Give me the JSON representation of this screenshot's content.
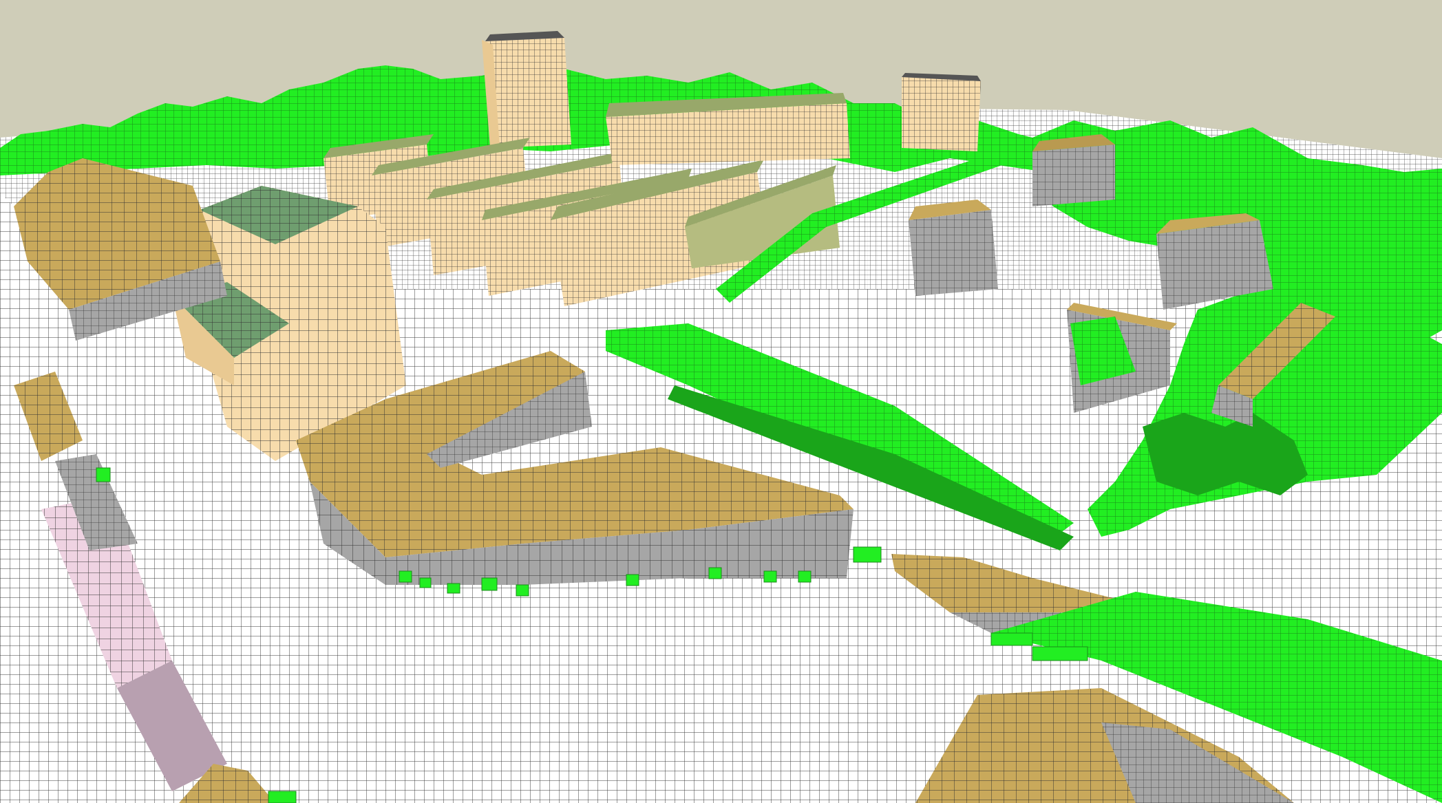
{
  "scene": {
    "kind": "voxelized-3d-city-model",
    "view": "perspective-aerial",
    "colors": {
      "sky": "#cfcdb8",
      "ground": "#ffffff",
      "grid_line": "#222222",
      "vegetation": "#22ee22",
      "vegetation_dark": "#1aa51a",
      "roof_ochre": "#c9a95b",
      "roof_green": "#6f9e6f",
      "facade_cream": "#f7dcac",
      "facade_gray": "#a6a6a6",
      "facade_pink": "#efd3e2",
      "edge": "#333333"
    },
    "elements": [
      {
        "name": "ground-grid",
        "material": "ground"
      },
      {
        "name": "tower-left-tall",
        "material": "facade_cream"
      },
      {
        "name": "tower-center-distant",
        "material": "facade_cream"
      },
      {
        "name": "slab-block-row-cream",
        "material": "facade_cream"
      },
      {
        "name": "ochre-roof-slab-building",
        "material": "roof_ochre"
      },
      {
        "name": "green-roof-tower",
        "material": "roof_green"
      },
      {
        "name": "gray-cube-building",
        "material": "facade_gray"
      },
      {
        "name": "pink-facade-building",
        "material": "facade_pink"
      },
      {
        "name": "railway-vegetation-strip",
        "material": "vegetation"
      },
      {
        "name": "tree-clusters",
        "material": "vegetation"
      }
    ]
  }
}
